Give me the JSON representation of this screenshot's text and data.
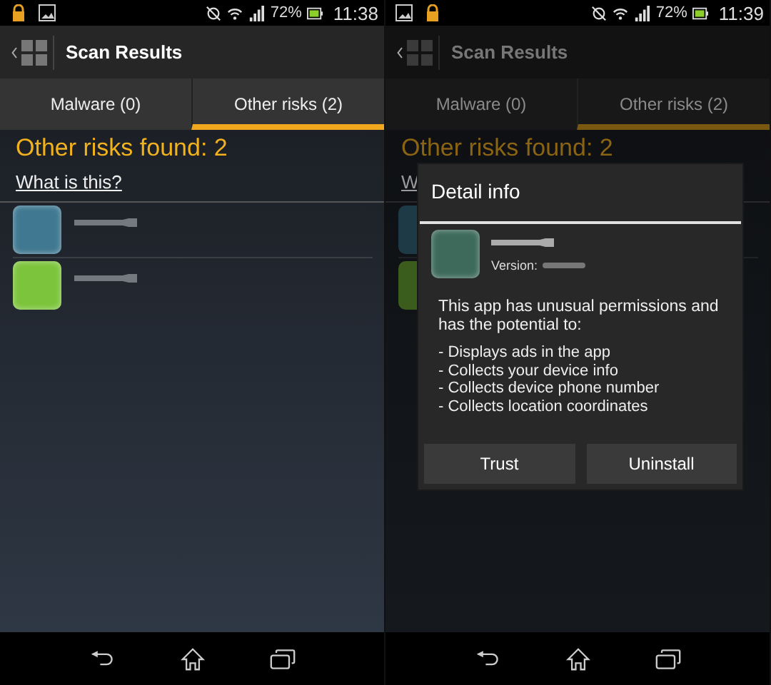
{
  "screens": [
    {
      "notifications": [
        {
          "kind": "lock"
        },
        {
          "kind": "image"
        }
      ],
      "battery": "72%",
      "time": "11:38",
      "title": "Scan Results",
      "tabs": [
        {
          "label": "Malware (0)",
          "selected": false
        },
        {
          "label": "Other risks (2)",
          "selected": true
        }
      ],
      "heading": "Other risks found: 2",
      "link": "What is this?",
      "apps": [
        {
          "color": "#3f7890"
        },
        {
          "color": "#7cc43c"
        }
      ]
    },
    {
      "notifications": [
        {
          "kind": "image"
        },
        {
          "kind": "lock"
        }
      ],
      "battery": "72%",
      "time": "11:39",
      "title": "Scan Results",
      "tabs": [
        {
          "label": "Malware (0)",
          "selected": false
        },
        {
          "label": "Other risks (2)",
          "selected": true
        }
      ],
      "heading": "Other risks found: 2",
      "link": "W",
      "apps": [
        {
          "color": "#1d3a46"
        },
        {
          "color": "#3a5c1c"
        }
      ],
      "dialog": {
        "title": "Detail info",
        "version_label": "Version:",
        "message": "This app has unusual permissions and has the potential to:",
        "permissions": [
          "- Displays ads in the app",
          "- Collects your device info",
          "- Collects device phone number",
          "- Collects location coordinates"
        ],
        "buttons": [
          "Trust",
          "Uninstall"
        ]
      }
    }
  ]
}
